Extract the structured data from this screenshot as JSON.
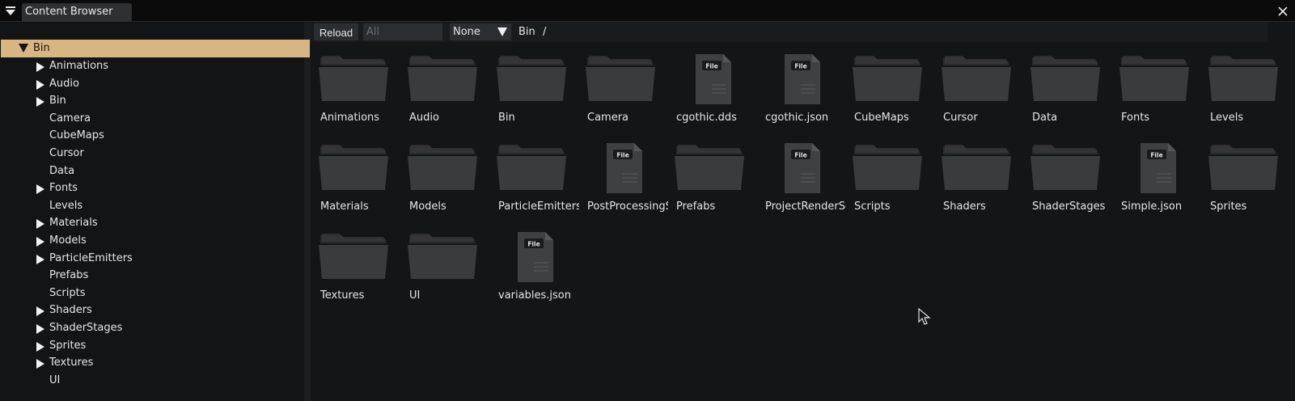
{
  "window": {
    "tab_title": "Content Browser",
    "menu_icon": "triangle-down-icon",
    "close_icon": "close-icon"
  },
  "colors": {
    "selection": "#d7b684",
    "folder": "#3a3b3d",
    "file": "#3f4042",
    "background": "#141516"
  },
  "tree": {
    "root": "Bin",
    "items": [
      {
        "label": "Animations",
        "expandable": true
      },
      {
        "label": "Audio",
        "expandable": true
      },
      {
        "label": "Bin",
        "expandable": true
      },
      {
        "label": "Camera",
        "expandable": false
      },
      {
        "label": "CubeMaps",
        "expandable": false
      },
      {
        "label": "Cursor",
        "expandable": false
      },
      {
        "label": "Data",
        "expandable": false
      },
      {
        "label": "Fonts",
        "expandable": true
      },
      {
        "label": "Levels",
        "expandable": false
      },
      {
        "label": "Materials",
        "expandable": true
      },
      {
        "label": "Models",
        "expandable": true
      },
      {
        "label": "ParticleEmitters",
        "expandable": true
      },
      {
        "label": "Prefabs",
        "expandable": false
      },
      {
        "label": "Scripts",
        "expandable": false
      },
      {
        "label": "Shaders",
        "expandable": true
      },
      {
        "label": "ShaderStages",
        "expandable": true
      },
      {
        "label": "Sprites",
        "expandable": true
      },
      {
        "label": "Textures",
        "expandable": true
      },
      {
        "label": "UI",
        "expandable": false
      }
    ]
  },
  "toolbar": {
    "reload_label": "Reload",
    "filter_placeholder": "All",
    "sort_value": "None",
    "breadcrumb": [
      "Bin",
      "/"
    ]
  },
  "grid": {
    "file_badge": "File",
    "items": [
      {
        "label": "Animations",
        "kind": "folder"
      },
      {
        "label": "Audio",
        "kind": "folder"
      },
      {
        "label": "Bin",
        "kind": "folder"
      },
      {
        "label": "Camera",
        "kind": "folder"
      },
      {
        "label": "cgothic.dds",
        "kind": "file"
      },
      {
        "label": "cgothic.json",
        "kind": "file"
      },
      {
        "label": "CubeMaps",
        "kind": "folder"
      },
      {
        "label": "Cursor",
        "kind": "folder"
      },
      {
        "label": "Data",
        "kind": "folder"
      },
      {
        "label": "Fonts",
        "kind": "folder"
      },
      {
        "label": "Levels",
        "kind": "folder"
      },
      {
        "label": "Materials",
        "kind": "folder"
      },
      {
        "label": "Models",
        "kind": "folder"
      },
      {
        "label": "ParticleEmitters",
        "kind": "folder"
      },
      {
        "label": "PostProcessingS",
        "kind": "file"
      },
      {
        "label": "Prefabs",
        "kind": "folder"
      },
      {
        "label": "ProjectRenderSe",
        "kind": "file"
      },
      {
        "label": "Scripts",
        "kind": "folder"
      },
      {
        "label": "Shaders",
        "kind": "folder"
      },
      {
        "label": "ShaderStages",
        "kind": "folder"
      },
      {
        "label": "Simple.json",
        "kind": "file"
      },
      {
        "label": "Sprites",
        "kind": "folder"
      },
      {
        "label": "Textures",
        "kind": "folder"
      },
      {
        "label": "UI",
        "kind": "folder"
      },
      {
        "label": "variables.json",
        "kind": "file"
      }
    ]
  }
}
